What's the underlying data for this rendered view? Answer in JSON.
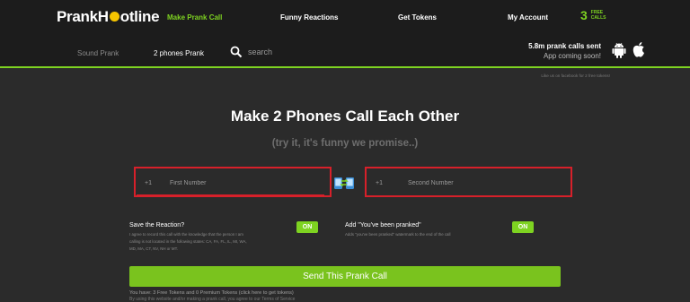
{
  "header": {
    "logo_prefix": "Prank",
    "logo_suffix": "otline",
    "nav": [
      "Make Prank Call",
      "Funny Reactions",
      "Get Tokens",
      "My Account"
    ],
    "free_calls": {
      "count": "3",
      "label_line1": "FREE",
      "label_line2": "CALLS"
    }
  },
  "subnav": {
    "sound_prank": "Sound Prank",
    "two_phones": "2 phones Prank",
    "search_placeholder": "search",
    "stats_count": "5.8m prank calls sent",
    "stats_app": "App coming soon!"
  },
  "facebook_note": "Like us on facebook for 2 free tokens!",
  "main": {
    "title": "Make 2 Phones Call Each Other",
    "subtitle": "(try it, it's funny we promise..)",
    "first": {
      "prefix": "+1",
      "placeholder": "First Number"
    },
    "second": {
      "prefix": "+1",
      "placeholder": "Second Number"
    }
  },
  "options": {
    "save_title": "Save the Reaction?",
    "save_desc_1": "I agree to record this call with the knowledge that the person I am",
    "save_desc_2": "calling is not located in the following states: CA, FA, FL, IL, MI, WA,",
    "save_desc_3": "MD, MA, CT, NV, NH or MT.",
    "save_toggle": "ON",
    "pranked_title": "Add \"You've been pranked\"",
    "pranked_desc": "Adds \"you've been pranked\" watermark to the end of the call",
    "pranked_toggle": "ON"
  },
  "send_button": "Send This Prank Call",
  "tokens_note": "You have: 3 Free Tokens and 0 Premium Tokens (click here to get tokens)",
  "legal_note": "By using this website and/or making a prank call, you agree to our Terms of Service",
  "colors": {
    "accent": "#7ed321",
    "highlight": "#d7202a",
    "background": "#2b2b2b",
    "bar": "#1c1c1c"
  }
}
